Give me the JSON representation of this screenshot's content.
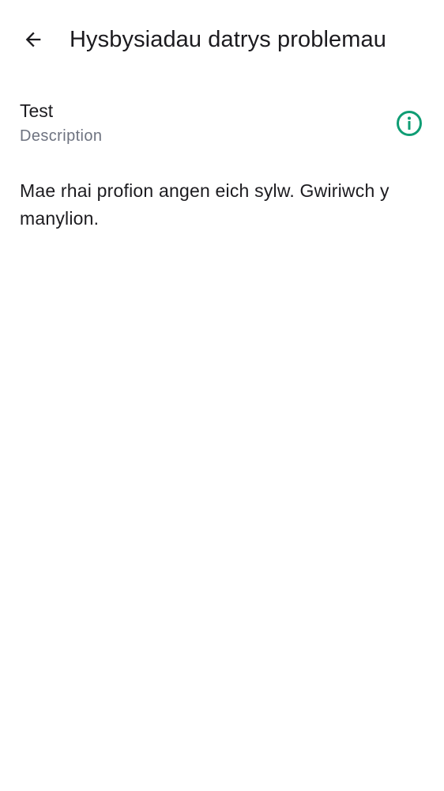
{
  "header": {
    "back_icon": "arrow-back-icon",
    "title": "Hysbysiadau datrys problemau"
  },
  "item": {
    "title": "Test",
    "description": "Description",
    "info_icon": "info-circle-icon",
    "accent_color": "#0f9d74"
  },
  "message": "Mae rhai profion angen eich sylw. Gwiriwch y manylion."
}
